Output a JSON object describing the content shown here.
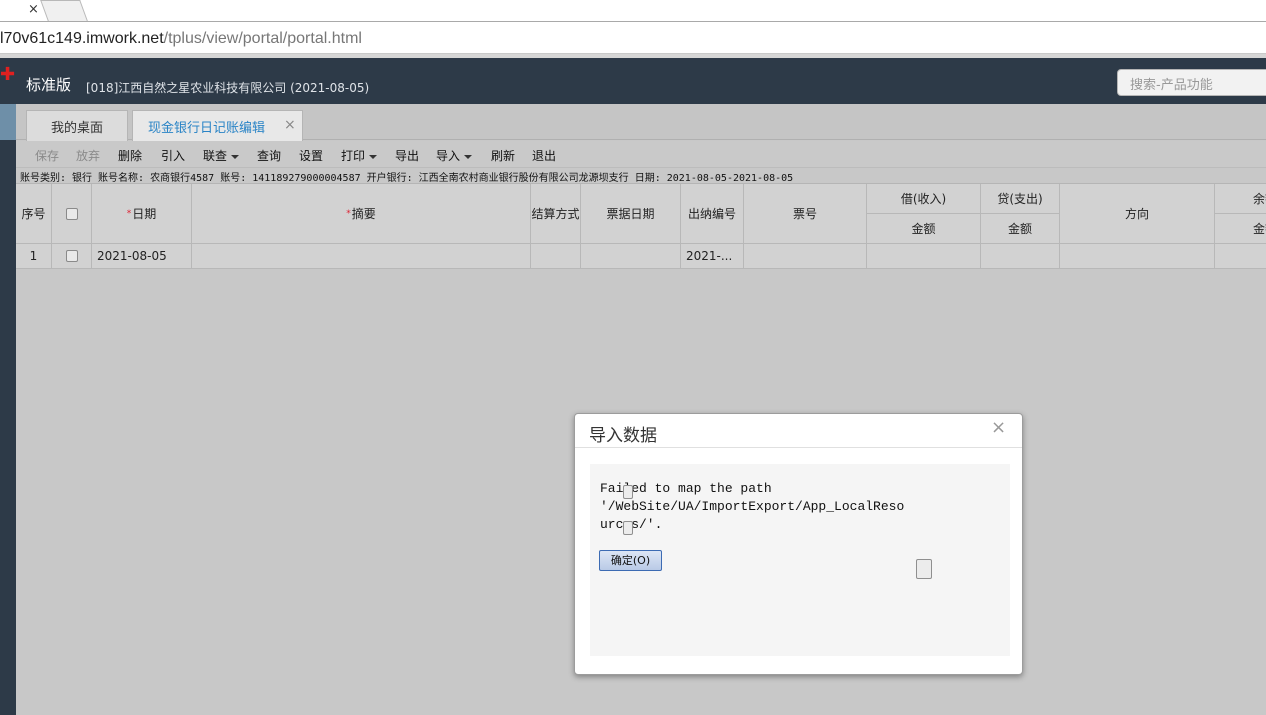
{
  "browser": {
    "tab_close_glyph": "×",
    "url_host": "l70v61c149.imwork.net",
    "url_path": "/tplus/view/portal/portal.html"
  },
  "header": {
    "logo_glyph": "✚",
    "edition": "标准版",
    "company": "[018]江西自然之星农业科技有限公司   (2021-08-05)",
    "search_placeholder": "搜索-产品功能"
  },
  "tabs": {
    "home": "我的桌面",
    "active": "现金银行日记账编辑",
    "close_glyph": "×"
  },
  "toolbar": {
    "save": "保存",
    "abandon": "放弃",
    "delete": "删除",
    "import_in": "引入",
    "link_query": "联查",
    "query": "查询",
    "settings": "设置",
    "print": "打印",
    "export": "导出",
    "import": "导入",
    "refresh": "刷新",
    "exit": "退出"
  },
  "info_line": "账号类别: 银行  账号名称: 农商银行4587  账号: 141189279000004587  开户银行: 江西全南农村商业银行股份有限公司龙源坝支行  日期: 2021-08-05-2021-08-05",
  "grid": {
    "headers": {
      "seq": "序号",
      "date": "日期",
      "summary": "摘要",
      "settle": "结算方式",
      "bill_date": "票据日期",
      "cashier_no": "出纳编号",
      "bill_no": "票号",
      "debit": "借(收入)",
      "credit": "贷(支出)",
      "direction": "方向",
      "balance": "余额",
      "amount": "金额",
      "required_mark": "*"
    },
    "rows": [
      {
        "seq": "1",
        "date": "2021-08-05",
        "cashier_no": "2021-..."
      }
    ]
  },
  "dialog": {
    "title": "导入数据",
    "close_glyph": "×",
    "message": "Failed to map the path\n'/WebSite/UA/ImportExport/App_LocalReso\nurces/'.",
    "ok_button": "确定(O)"
  },
  "colors": {
    "header_bg": "#2d3a48",
    "active_tab_text": "#2a84c6",
    "logo_red": "#e02020"
  }
}
